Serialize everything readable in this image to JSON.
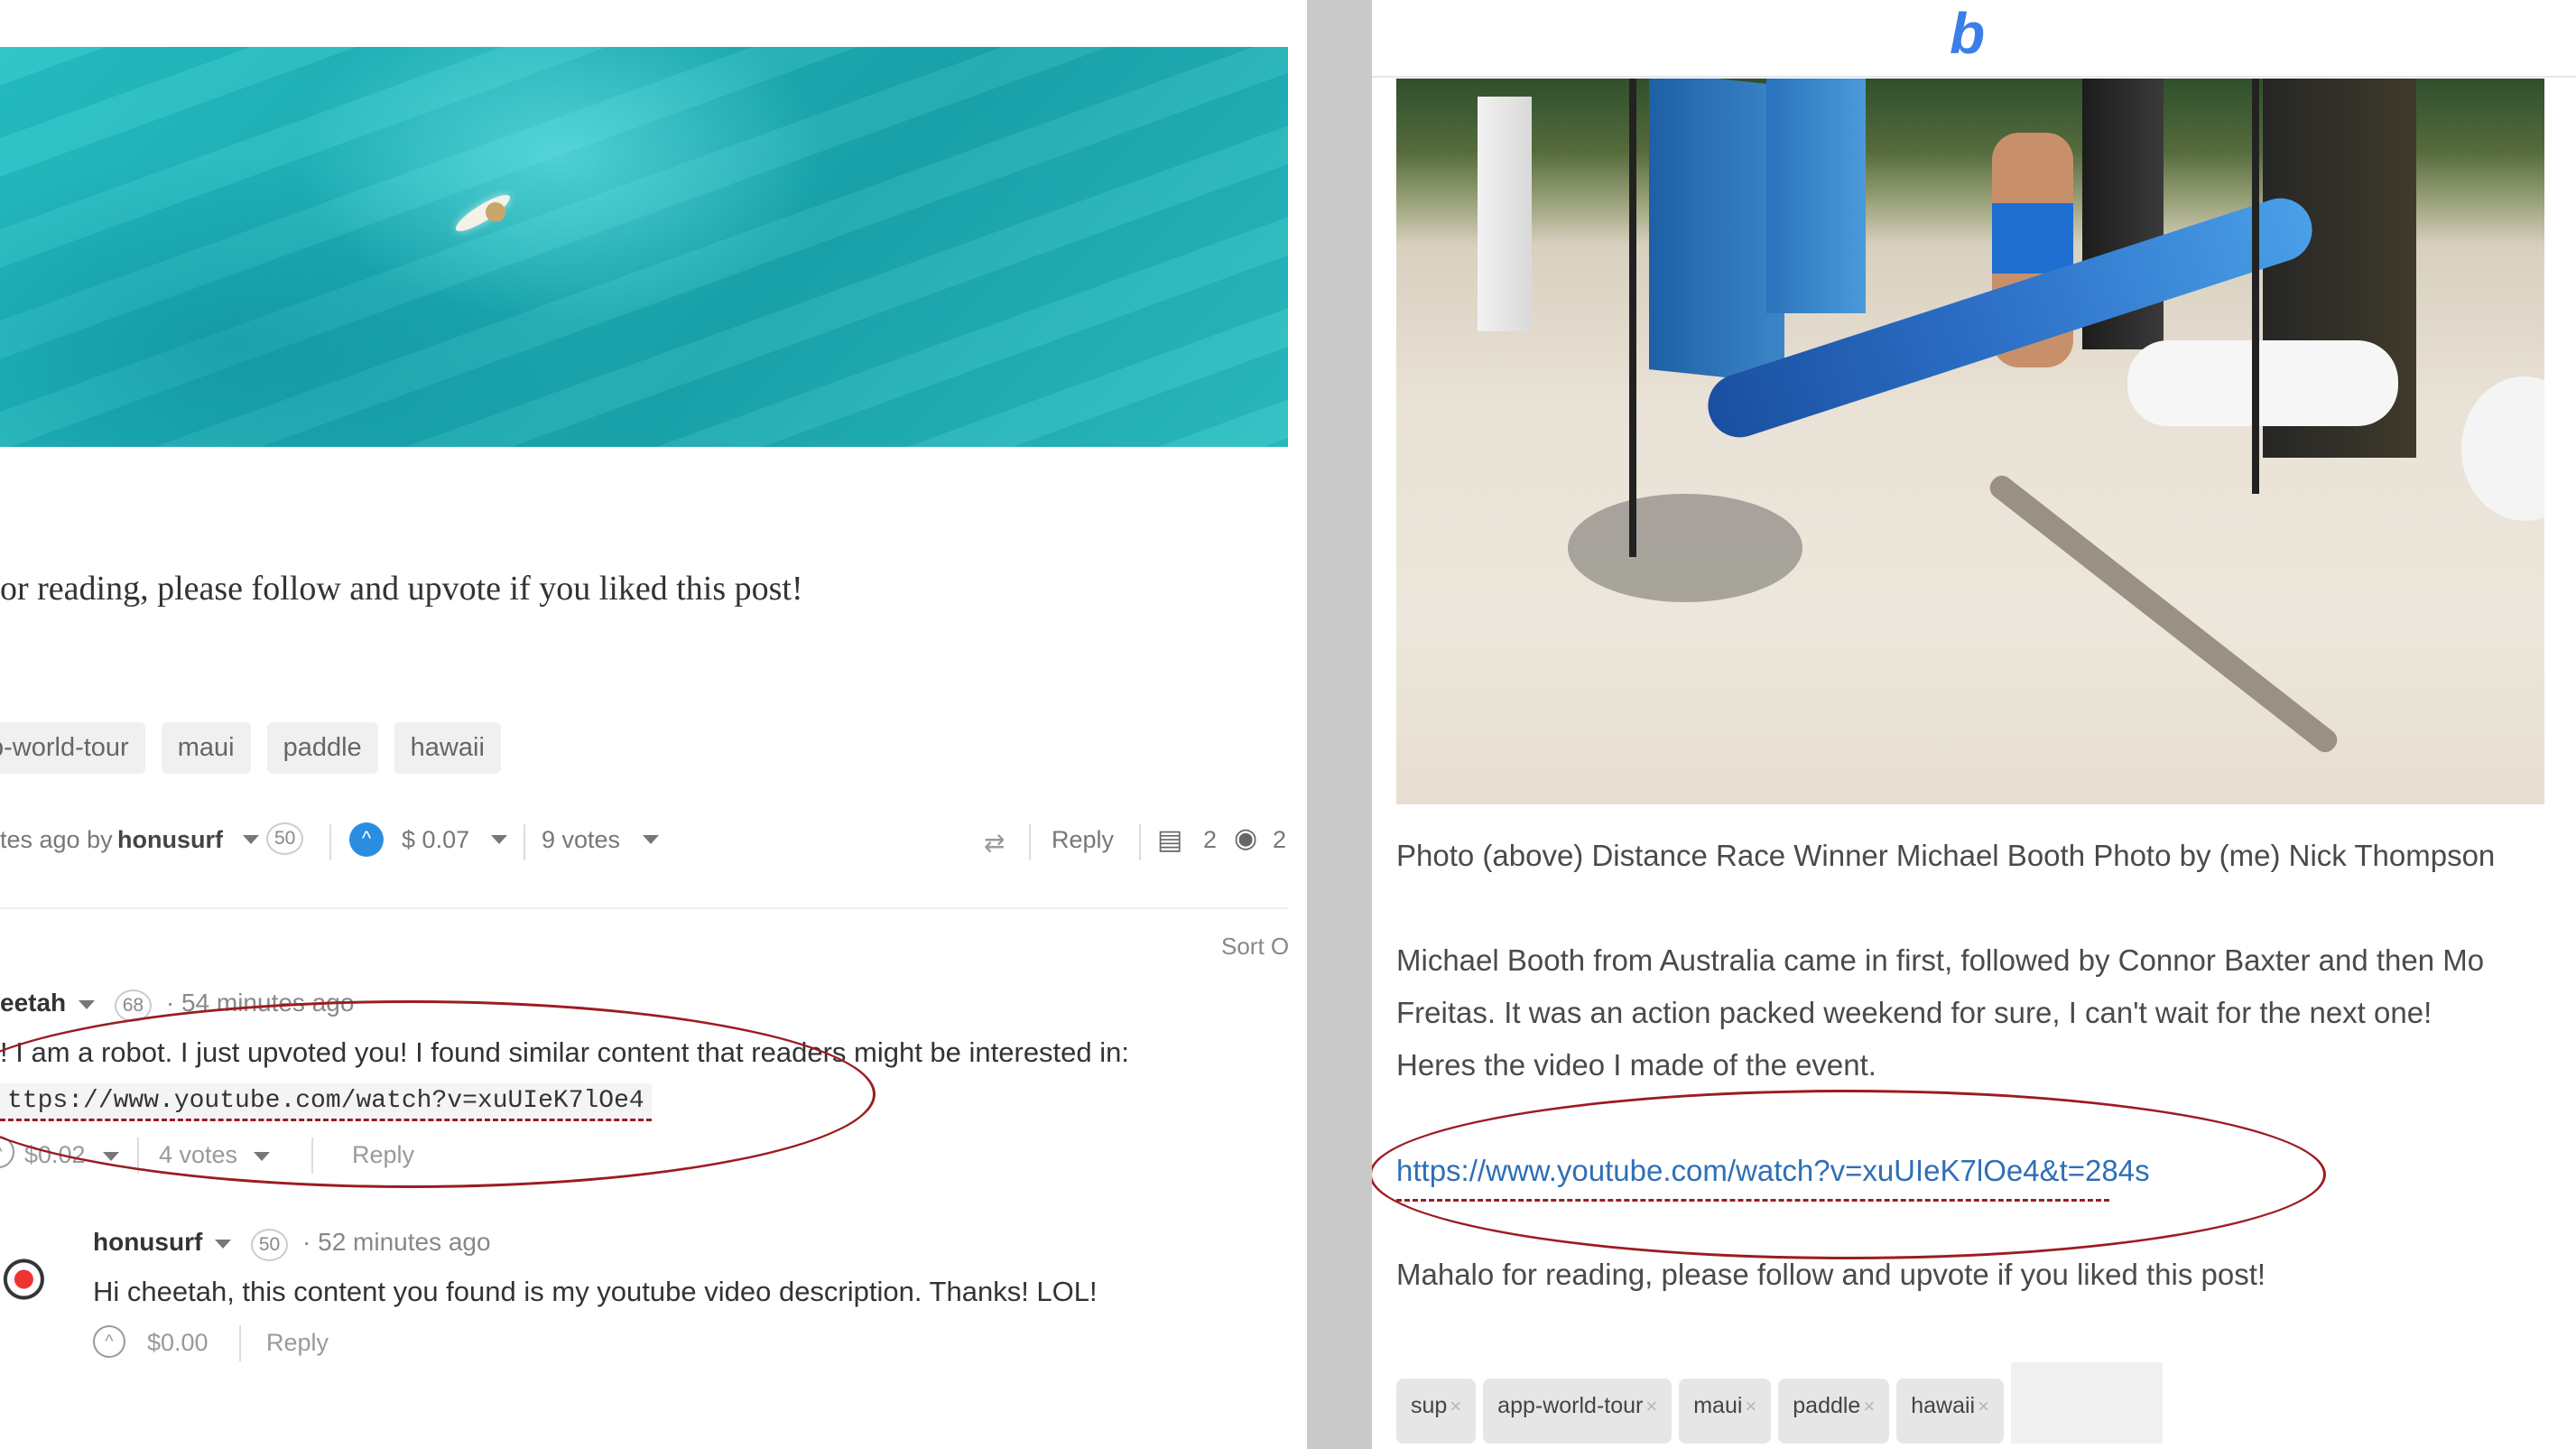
{
  "left_panel": {
    "closing_text": "or reading, please follow and upvote if you liked this post!",
    "tags": [
      "p-world-tour",
      "maui",
      "paddle",
      "hawaii"
    ],
    "post_meta": {
      "prefix": "tes ago by",
      "author": "honusurf",
      "reputation": "50",
      "payout_symbol": "$",
      "payout": "0.07",
      "votes": "9 votes",
      "reply": "Reply",
      "comments_count": "2",
      "views_count": "2"
    },
    "sort_label": "Sort O",
    "comments": [
      {
        "author": "eetah",
        "reputation": "68",
        "time": "· 54 minutes ago",
        "text": "! I am a robot. I just upvoted you! I found similar content that readers might be interested in:",
        "link": "ttps://www.youtube.com/watch?v=xuUIeK7lOe4",
        "payout": "$0.02",
        "votes": "4 votes",
        "reply": "Reply"
      },
      {
        "author": "honusurf",
        "reputation": "50",
        "time": "· 52 minutes ago",
        "text": "Hi cheetah, this content you found is my youtube video description. Thanks! LOL!",
        "payout": "$0.00",
        "reply": "Reply"
      }
    ]
  },
  "right_panel": {
    "logo": "b",
    "photo_caption": "Photo (above) Distance Race Winner Michael Booth Photo by (me) Nick Thompson",
    "paragraph_lines": [
      "Michael Booth from Australia came in first, followed by Connor Baxter and then Mo",
      "Freitas. It was an action packed weekend for sure, I can't wait for the next one!",
      "Heres the video I made of the event."
    ],
    "video_link": "https://www.youtube.com/watch?v=xuUIeK7lOe4&t=284s",
    "closing_text": "Mahalo for reading, please follow and upvote if you liked this post!",
    "tags": [
      "sup",
      "app-world-tour",
      "maui",
      "paddle",
      "hawaii"
    ],
    "tag_remove_glyph": "×"
  },
  "colors": {
    "annotation_ellipse": "#9b1c22",
    "link_blue": "#2f6fb5",
    "logo_blue": "#3b7ee8",
    "upvote_blue": "#2a8ee0",
    "gutter": "#c9c9c9"
  }
}
